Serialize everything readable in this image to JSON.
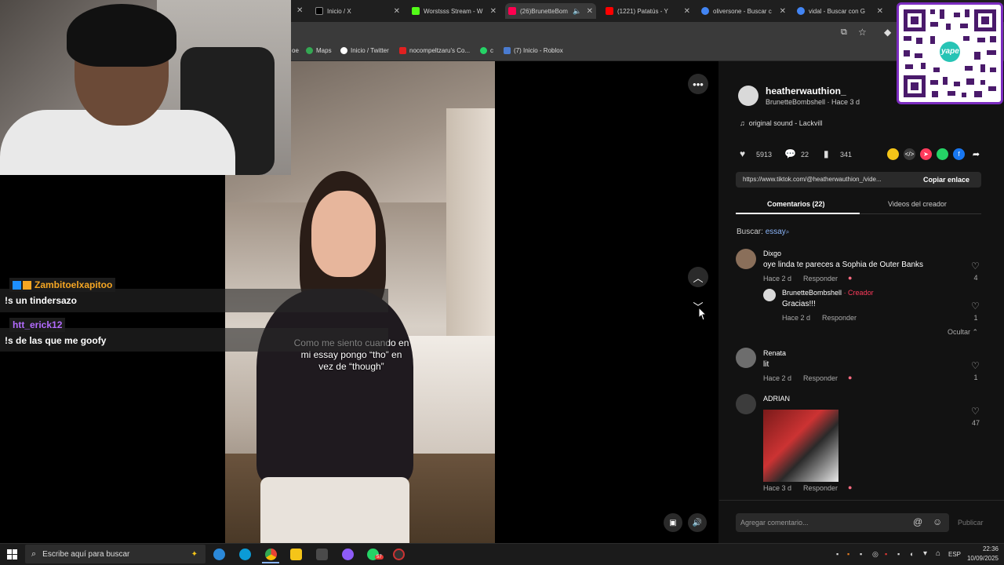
{
  "browser": {
    "tabs": [
      {
        "label": "Inicio / X",
        "color": "#ffffff"
      },
      {
        "label": "Worstsss Stream - W",
        "color": "#53fc18"
      },
      {
        "label": "(26)BrunetteBom",
        "color": "#ff0050"
      },
      {
        "label": "(1221) Patatús - Y",
        "color": "#ff0000"
      },
      {
        "label": "oliversone - Buscar c",
        "color": "#4285f4"
      },
      {
        "label": "vidal - Buscar con G",
        "color": "#4285f4"
      }
    ],
    "bookmarks": [
      {
        "label": "Maps",
        "color": "#34a853"
      },
      {
        "label": "Inicio / Twitter",
        "color": "#ffffff"
      },
      {
        "label": "nocompeltzaru's Co...",
        "color": "#e02020"
      },
      {
        "label": "c",
        "color": "#25d366"
      },
      {
        "label": "(7) Inicio - Roblox",
        "color": "#4a7bd0"
      }
    ]
  },
  "video": {
    "caption": "Como me siento cuando en mi essay pongo “tho” en vez de “though”"
  },
  "chat": [
    {
      "user": "Zambitoelxapitoo",
      "user_color": "#f5a623",
      "message": "!s un tindersazo"
    },
    {
      "user": "htt_erick12",
      "user_color": "#b36bff",
      "message": "!s de las que me goofy"
    }
  ],
  "post": {
    "username": "heatherwauthion_",
    "subtitle": "BrunetteBombshell · Hace 3 d",
    "sound": "original sound - Lackvill",
    "likes": "5913",
    "comments": "22",
    "saves": "341",
    "link": "https://www.tiktok.com/@heatherwauthion_/vide...",
    "copy_label": "Copiar enlace"
  },
  "tabs": {
    "comments": "Comentarios (22)",
    "creator_videos": "Videos del creador"
  },
  "search": {
    "prefix": "Buscar:",
    "term": "essay"
  },
  "comments": [
    {
      "user": "Dixgo",
      "text": "oye linda te pareces a Sophia de Outer Banks",
      "time": "Hace 2 d",
      "reply": "Responder",
      "likes": "4"
    },
    {
      "user": "BrunetteBombshell",
      "creator_tag": "· Creador",
      "text": "Gracias!!!",
      "time": "Hace 2 d",
      "reply": "Responder",
      "likes": "1"
    },
    {
      "user": "Renata",
      "text": "lit",
      "time": "Hace 2 d",
      "reply": "Responder",
      "likes": "1"
    },
    {
      "user": "ADRIAN",
      "text": "",
      "time": "Hace 3 d",
      "reply": "Responder",
      "likes": "47"
    }
  ],
  "hide_label": "Ocultar",
  "composer": {
    "placeholder": "Agregar comentario...",
    "publish": "Publicar"
  },
  "taskbar": {
    "search_placeholder": "Escribe aquí para buscar",
    "whatsapp_badge": "57",
    "lang": "ESP",
    "time": "22:36",
    "date": "10/09/2025"
  },
  "qr_brand": "yape"
}
